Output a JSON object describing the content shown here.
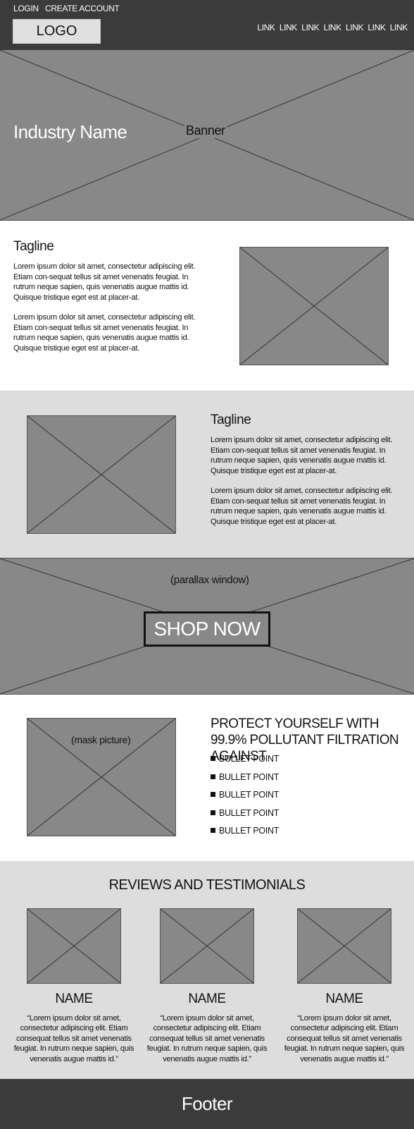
{
  "header": {
    "login": "LOGIN",
    "create_account": "CREATE ACCOUNT",
    "logo": "LOGO",
    "nav": [
      "LINK",
      "LINK",
      "LINK",
      "LINK",
      "LINK",
      "LINK",
      "LINK"
    ]
  },
  "banner": {
    "industry_name": "Industry Name",
    "label": "Banner"
  },
  "section1": {
    "tagline": "Tagline",
    "paragraphs": [
      "Lorem ipsum dolor sit amet, consectetur adipiscing elit. Etiam con-sequat tellus sit amet venenatis feugiat. In rutrum neque sapien, quis venenatis augue mattis id. Quisque tristique eget est at placer-at.",
      "Lorem ipsum dolor sit amet, consectetur adipiscing elit. Etiam con-sequat tellus sit amet venenatis feugiat. In rutrum neque sapien, quis venenatis augue mattis id. Quisque tristique eget est at placer-at."
    ]
  },
  "section2": {
    "tagline": "Tagline",
    "paragraphs": [
      "Lorem ipsum dolor sit amet, consectetur adipiscing elit. Etiam con-sequat tellus sit amet venenatis feugiat. In rutrum neque sapien, quis venenatis augue mattis id. Quisque tristique eget est at placer-at.",
      "Lorem ipsum dolor sit amet, consectetur adipiscing elit. Etiam con-sequat tellus sit amet venenatis feugiat. In rutrum neque sapien, quis venenatis augue mattis id. Quisque tristique eget est at placer-at."
    ]
  },
  "parallax": {
    "label": "(parallax window)",
    "cta": "SHOP NOW"
  },
  "protect": {
    "image_label": "(mask picture)",
    "title": "PROTECT YOURSELF WITH 99.9% POLLUTANT FILTRATION AGAINST",
    "bullets": [
      "BULLET POINT",
      "BULLET POINT",
      "BULLET POINT",
      "BULLET POINT",
      "BULLET POINT"
    ]
  },
  "reviews": {
    "title": "REVIEWS AND TESTIMONIALS",
    "items": [
      {
        "name": "NAME",
        "quote": "“Lorem ipsum dolor sit amet, consectetur adipiscing elit. Etiam consequat tellus sit amet venenatis feugiat. In rutrum neque sapien, quis venenatis augue mattis id.”"
      },
      {
        "name": "NAME",
        "quote": "“Lorem ipsum dolor sit amet, consectetur adipiscing elit. Etiam consequat tellus sit amet venenatis feugiat. In rutrum neque sapien, quis venenatis augue mattis id.”"
      },
      {
        "name": "NAME",
        "quote": "“Lorem ipsum dolor sit amet, consectetur adipiscing elit. Etiam consequat tellus sit amet venenatis feugiat. In rutrum neque sapien, quis venenatis augue mattis id.”"
      }
    ]
  },
  "footer": {
    "label": "Footer"
  },
  "colors": {
    "header_bg": "#3b3b3b",
    "placeholder": "#888888",
    "section_alt_bg": "#dddddd"
  }
}
